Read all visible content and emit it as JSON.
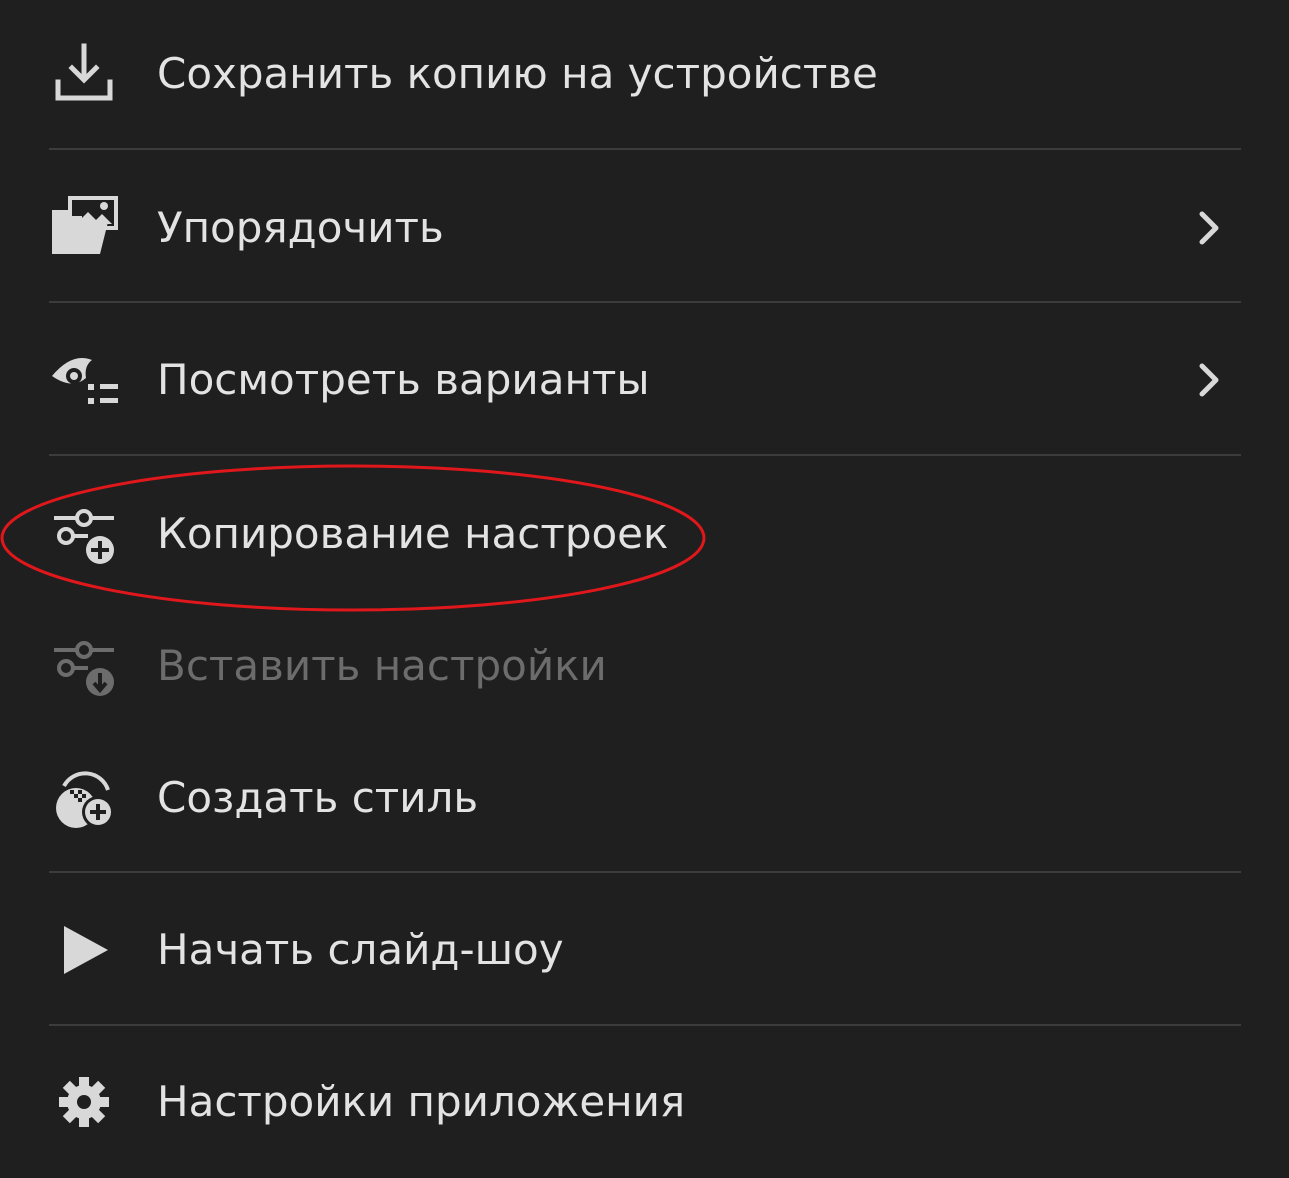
{
  "menu": {
    "items": [
      {
        "label": "Сохранить копию на устройстве",
        "icon": "download-icon",
        "has_submenu": false,
        "disabled": false
      },
      {
        "label": "Упорядочить",
        "icon": "folder-image-icon",
        "has_submenu": true,
        "disabled": false
      },
      {
        "label": "Посмотреть варианты",
        "icon": "eye-list-icon",
        "has_submenu": true,
        "disabled": false
      },
      {
        "label": "Копирование настроек",
        "icon": "copy-settings-icon",
        "has_submenu": false,
        "disabled": false,
        "highlighted": true
      },
      {
        "label": "Вставить настройки",
        "icon": "paste-settings-icon",
        "has_submenu": false,
        "disabled": true
      },
      {
        "label": "Создать стиль",
        "icon": "create-preset-icon",
        "has_submenu": false,
        "disabled": false
      },
      {
        "label": "Начать слайд-шоу",
        "icon": "play-icon",
        "has_submenu": false,
        "disabled": false
      },
      {
        "label": "Настройки приложения",
        "icon": "gear-icon",
        "has_submenu": false,
        "disabled": false
      }
    ]
  },
  "colors": {
    "background": "#1f1f1f",
    "text": "#e3e3e3",
    "text_disabled": "#6c6c6c",
    "divider": "#3c3c3c",
    "icon": "#d8d8d8",
    "annotation": "#e0171b"
  }
}
